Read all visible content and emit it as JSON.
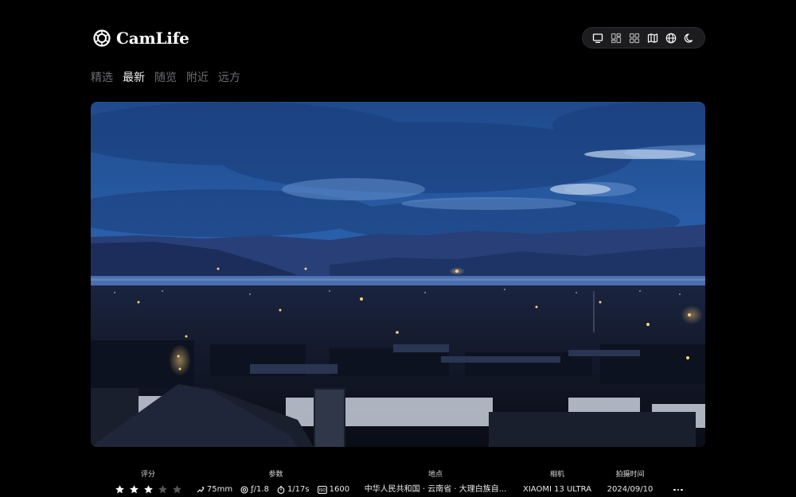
{
  "app": {
    "brand": "CamLife"
  },
  "nav": {
    "tabs": [
      {
        "label": "精选",
        "active": false
      },
      {
        "label": "最新",
        "active": true
      },
      {
        "label": "随览",
        "active": false
      },
      {
        "label": "附近",
        "active": false
      },
      {
        "label": "远方",
        "active": false
      }
    ]
  },
  "toolbar": {
    "icons": [
      "single-view-icon",
      "waterfall-view-icon",
      "grid-view-icon",
      "map-icon",
      "globe-icon",
      "dark-mode-moon-icon"
    ]
  },
  "photo_info": {
    "rating": {
      "label": "评分",
      "value": 3,
      "max": 5
    },
    "params": {
      "label": "参数",
      "focal_length": "75mm",
      "aperture": "ƒ/1.8",
      "shutter": "1/17s",
      "iso": "1600"
    },
    "location": {
      "label": "地点",
      "value": "中华人民共和国 · 云南省 · 大理白族自..."
    },
    "camera": {
      "label": "相机",
      "value": "XIAOMI 13 ULTRA"
    },
    "date": {
      "label": "拍摄时间",
      "value": "2024/09/10"
    }
  },
  "colors": {
    "background": "#000000",
    "toolbar_bg": "#1c1c1e",
    "inactive_tab": "#6e6e73",
    "active_tab": "#f2f2f2",
    "star_filled": "#ffffff",
    "star_empty": "#555555"
  }
}
